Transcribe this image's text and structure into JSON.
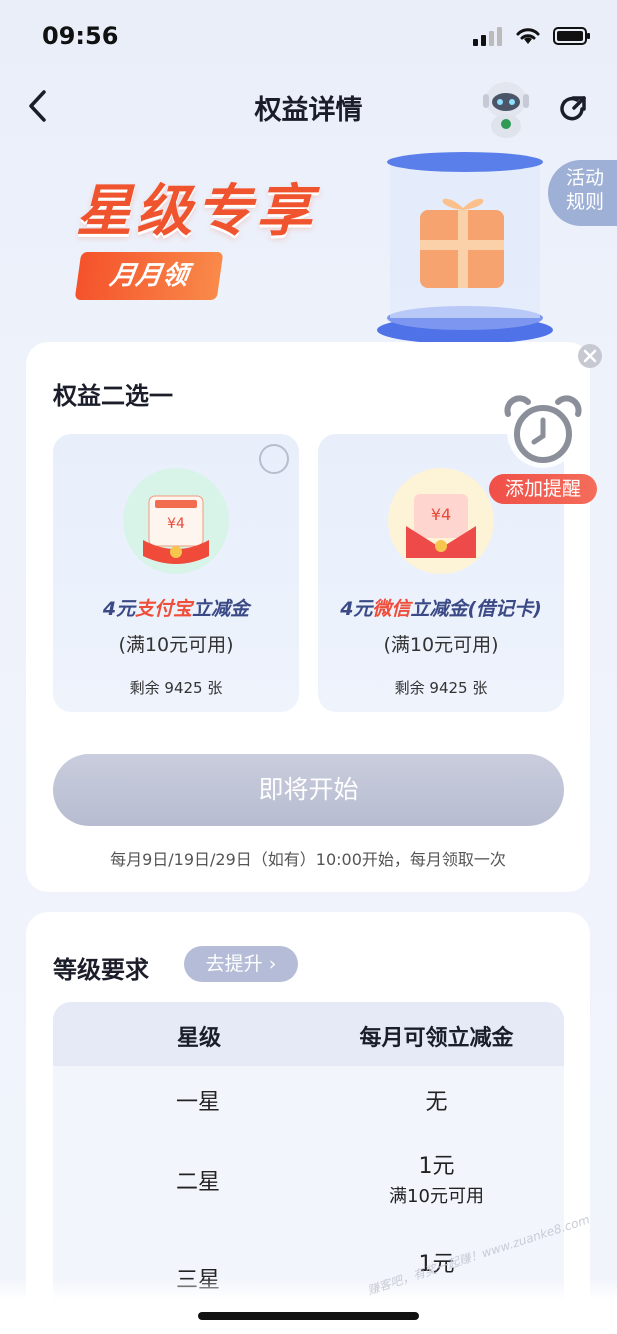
{
  "status": {
    "time": "09:56"
  },
  "nav": {
    "title": "权益详情"
  },
  "banner": {
    "title": "星级专享",
    "badge": "月月领",
    "rules_line1": "活动",
    "rules_line2": "规则"
  },
  "benefit": {
    "title": "权益二选一",
    "options": [
      {
        "name_prefix": "4元",
        "name_highlight": "支付宝",
        "name_suffix": "立减金",
        "condition": "(满10元可用)",
        "remaining": "剩余 9425 张",
        "icon_amount": "¥4",
        "icon_label": "支付宝红包"
      },
      {
        "name_prefix": "4元",
        "name_highlight": "微信",
        "name_suffix": "立减金(借记卡)",
        "condition": "(满10元可用)",
        "remaining": "剩余 9425 张",
        "icon_amount": "¥4"
      }
    ],
    "button": "即将开始",
    "note": "每月9日/19日/29日（如有）10:00开始，每月领取一次"
  },
  "reminder": {
    "label": "添加提醒"
  },
  "level": {
    "title": "等级要求",
    "upgrade": "去提升",
    "headers": [
      "星级",
      "每月可领立减金"
    ],
    "rows": [
      {
        "star": "一星",
        "value": "无",
        "sub": ""
      },
      {
        "star": "二星",
        "value": "1元",
        "sub": "满10元可用"
      },
      {
        "star": "三星",
        "value": "1元",
        "sub": ""
      }
    ]
  },
  "watermark": "赚客吧，有奖一起赚！www.zuanke8.com"
}
